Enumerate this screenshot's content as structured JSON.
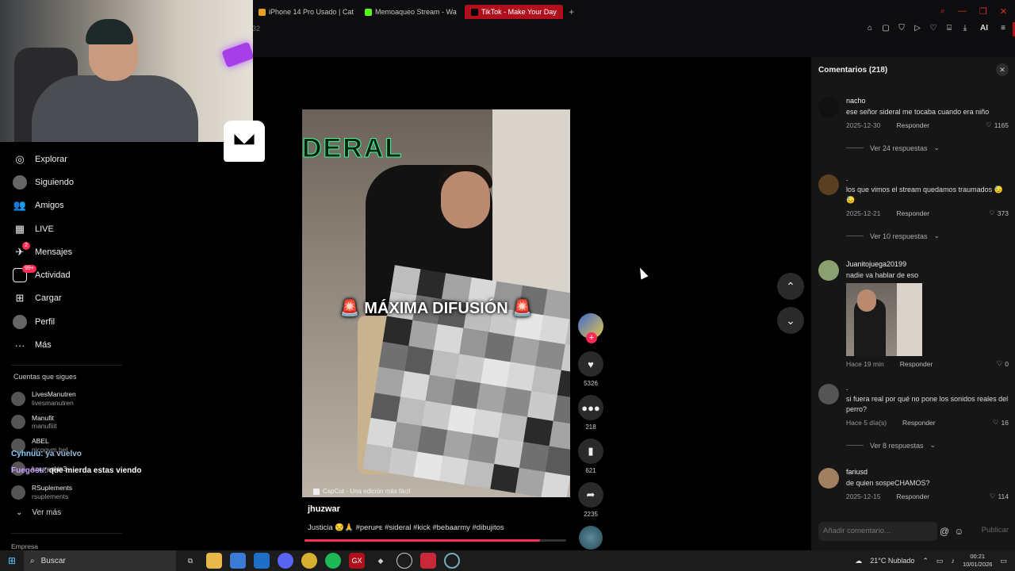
{
  "browser": {
    "tabs": [
      {
        "label": "iPhone 14 Pro Usado | Cat",
        "icon_color": "#e8a020",
        "active": false
      },
      {
        "label": "Memoaqueo Stream - Wa",
        "icon_color": "#53fc18",
        "active": false
      },
      {
        "label": "TikTok - Make Your Day",
        "icon_color": "#000000",
        "active": true
      }
    ],
    "new_tab": "+",
    "page_num": "32",
    "toolbar_ai": "AI",
    "accent": "#b0101b"
  },
  "overlay": {
    "chat": [
      {
        "user": "Cyhnuu:",
        "text": "ya vuelvo"
      },
      {
        "user": "Fuegosu:",
        "text": "que mierda estas viendo"
      }
    ]
  },
  "nav": {
    "items": [
      {
        "label": "Explorar",
        "icon": "compass-icon",
        "glyph": "◎"
      },
      {
        "label": "Siguiendo",
        "icon": "following-avatar-icon",
        "glyph": ""
      },
      {
        "label": "Amigos",
        "icon": "friends-icon",
        "glyph": "👥"
      },
      {
        "label": "LIVE",
        "icon": "live-icon",
        "glyph": "▦"
      },
      {
        "label": "Mensajes",
        "icon": "messages-icon",
        "glyph": "✈",
        "badge": "2"
      },
      {
        "label": "Actividad",
        "icon": "activity-icon",
        "glyph": "",
        "badge": "99+"
      },
      {
        "label": "Cargar",
        "icon": "upload-icon",
        "glyph": "⊞"
      },
      {
        "label": "Perfil",
        "icon": "profile-avatar-icon",
        "glyph": ""
      },
      {
        "label": "Más",
        "icon": "more-icon",
        "glyph": "···"
      }
    ],
    "following_heading": "Cuentas que sigues",
    "following": [
      {
        "name": "LivesManutren",
        "handle": "livesmanutren"
      },
      {
        "name": "Manufit",
        "handle": "manufiiit"
      },
      {
        "name": "ABEL",
        "handle": "nicogym.bel"
      },
      {
        "name": "luxury.skin3",
        "handle": ""
      },
      {
        "name": "RSuplements",
        "handle": "rsuplements"
      }
    ],
    "see_more": "Ver más",
    "company": "Empresa"
  },
  "video": {
    "overlay_top": "DERAL",
    "overlay_caption": "🚨 MÁXIMA DIFUSIÓN 🚨",
    "watermark": "CapCut · Una edición más fácil",
    "author": "jhuzwar",
    "description": "Justicia 😒🙏 #peruᴘᴇ #sideral #kick #bebaarmy #dibujitos",
    "progress": 0.9,
    "likes": "5326",
    "comments": "218",
    "saves": "621",
    "shares": "2235"
  },
  "comments_panel": {
    "title": "Comentarios (218)",
    "close": "✕",
    "reply_label": "Responder",
    "comments": [
      {
        "user": "nacho",
        "text": "ese señor sideral me tocaba cuando era niño",
        "date": "2025-12-30",
        "likes": "1165",
        "replies": "Ver 24 respuestas"
      },
      {
        "user": ".",
        "text": "los que vimos el stream quedamos traumados 😓😓",
        "date": "2025-12-21",
        "likes": "373",
        "replies": "Ver 10 respuestas"
      },
      {
        "user": "Juanitojuega20199",
        "text": "nadie va hablar de eso",
        "date": "Hace 19 min",
        "likes": "0",
        "replies": ""
      },
      {
        "user": ".",
        "text": "si fuera real por qué no pone los sonidos reales del perro?",
        "date": "Hace 5 día(s)",
        "likes": "16",
        "replies": "Ver 8 respuestas"
      },
      {
        "user": "fariusd",
        "text": "de quien sospeCHAMOS?",
        "date": "2025-12-15",
        "likes": "114",
        "replies": ""
      }
    ],
    "input_placeholder": "Añadir comentario...",
    "publish": "Publicar"
  },
  "taskbar": {
    "search": "Buscar",
    "weather": "21°C  Nublado",
    "time": "00:21",
    "date": "10/01/2026"
  }
}
